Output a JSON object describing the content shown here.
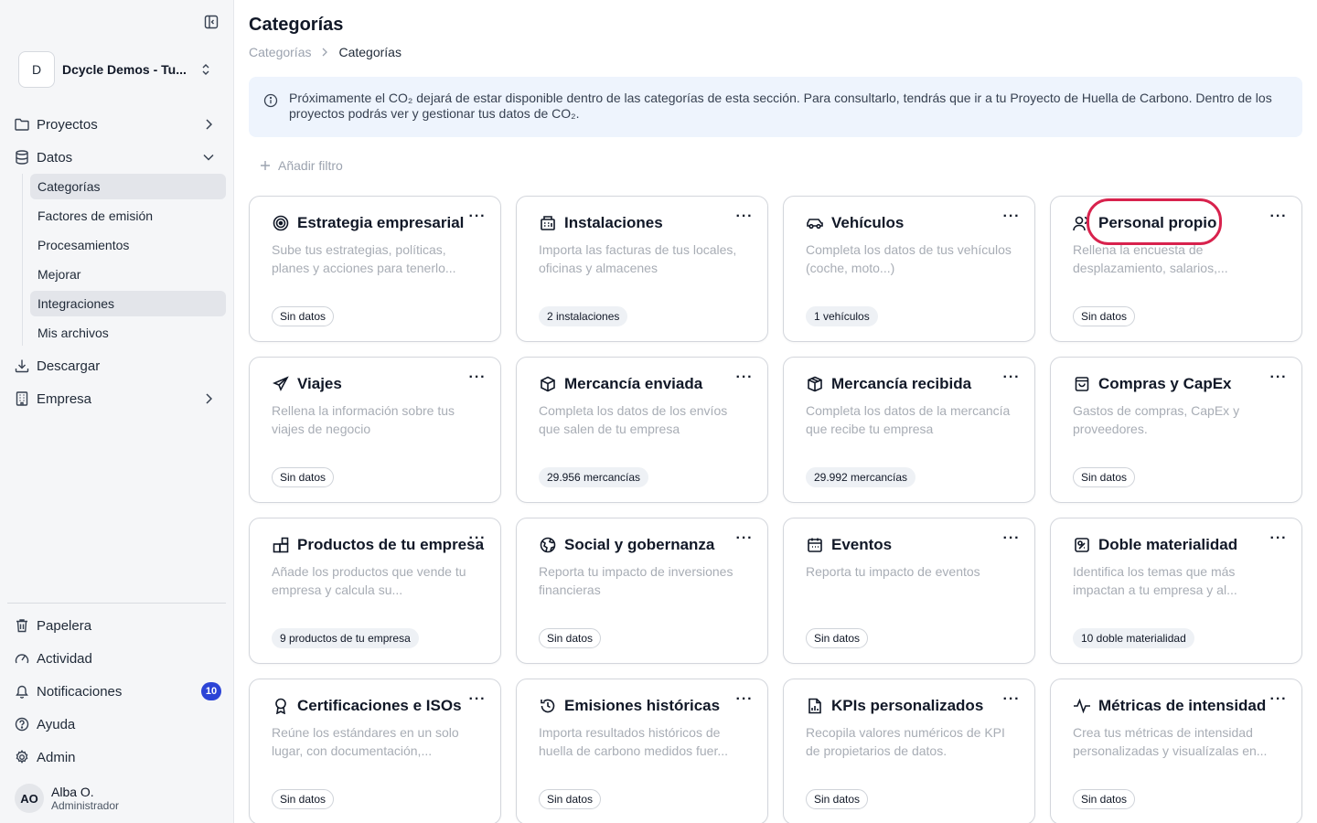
{
  "org": {
    "initial": "D",
    "name": "Dcycle Demos - Tu..."
  },
  "sidebar": {
    "projects": "Proyectos",
    "data": "Datos",
    "sub_items": [
      "Categorías",
      "Factores de emisión",
      "Procesamientos",
      "Mejorar",
      "Integraciones",
      "Mis archivos"
    ],
    "download": "Descargar",
    "company": "Empresa",
    "trash": "Papelera",
    "activity": "Actividad",
    "notifications": "Notificaciones",
    "notifications_count": "10",
    "help": "Ayuda",
    "admin": "Admin"
  },
  "user": {
    "initials": "AO",
    "name": "Alba O.",
    "role": "Administrador"
  },
  "page": {
    "title": "Categorías",
    "breadcrumb": [
      "Categorías",
      "Categorías"
    ],
    "info": "Próximamente el CO₂ dejará de estar disponible dentro de las categorías de esta sección. Para consultarlo, tendrás que ir a tu Proyecto de Huella de Carbono. Dentro de los proyectos podrás ver y gestionar tus datos de CO₂.",
    "add_filter": "Añadir filtro"
  },
  "cards": [
    {
      "title": "Estrategia empresarial",
      "icon": "target-icon",
      "desc": "Sube tus estrategias, políticas, planes y acciones para tenerlo...",
      "badge": "Sin datos",
      "filled": false
    },
    {
      "title": "Instalaciones",
      "icon": "building-icon",
      "desc": "Importa las facturas de tus locales, oficinas y almacenes",
      "badge": "2 instalaciones",
      "filled": true
    },
    {
      "title": "Vehículos",
      "icon": "car-icon",
      "desc": "Completa los datos de tus vehículos (coche, moto...)",
      "badge": "1 vehículos",
      "filled": true
    },
    {
      "title": "Personal propio",
      "icon": "users-icon",
      "desc": "Rellena la encuesta de desplazamiento, salarios,...",
      "badge": "Sin datos",
      "filled": false
    },
    {
      "title": "Viajes",
      "icon": "plane-icon",
      "desc": "Rellena la información sobre tus viajes de negocio",
      "badge": "Sin datos",
      "filled": false
    },
    {
      "title": "Mercancía enviada",
      "icon": "box-icon",
      "desc": "Completa los datos de los envíos que salen de tu empresa",
      "badge": "29.956 mercancías",
      "filled": true
    },
    {
      "title": "Mercancía recibida",
      "icon": "boxes-icon",
      "desc": "Completa los datos de la mercancía que recibe tu empresa",
      "badge": "29.992 mercancías",
      "filled": true
    },
    {
      "title": "Compras y CapEx",
      "icon": "shopping-bag-icon",
      "desc": "Gastos de compras, CapEx y proveedores.",
      "badge": "Sin datos",
      "filled": false
    },
    {
      "title": "Productos de tu empresa",
      "icon": "products-icon",
      "desc": "Añade los productos que vende tu empresa y calcula su...",
      "badge": "9 productos de tu empresa",
      "filled": true
    },
    {
      "title": "Social y gobernanza",
      "icon": "globe-icon",
      "desc": "Reporta tu impacto de inversiones financieras",
      "badge": "Sin datos",
      "filled": false
    },
    {
      "title": "Eventos",
      "icon": "calendar-icon",
      "desc": "Reporta tu impacto de eventos",
      "badge": "Sin datos",
      "filled": false
    },
    {
      "title": "Doble materialidad",
      "icon": "materiality-icon",
      "desc": "Identifica los temas que más impactan a tu empresa y al...",
      "badge": "10 doble materialidad",
      "filled": true
    },
    {
      "title": "Certificaciones e ISOs",
      "icon": "award-icon",
      "desc": "Reúne los estándares en un solo lugar, con documentación,...",
      "badge": "Sin datos",
      "filled": false
    },
    {
      "title": "Emisiones históricas",
      "icon": "history-icon",
      "desc": "Importa resultados históricos de huella de carbono medidos fuer...",
      "badge": "Sin datos",
      "filled": false
    },
    {
      "title": "KPIs personalizados",
      "icon": "file-chart-icon",
      "desc": "Recopila valores numéricos de KPI de propietarios de datos.",
      "badge": "Sin datos",
      "filled": false
    },
    {
      "title": "Métricas de intensidad",
      "icon": "activity-icon",
      "desc": "Crea tus métricas de intensidad personalizadas y visualízalas en...",
      "badge": "Sin datos",
      "filled": false
    }
  ],
  "card_menu": "···",
  "colors": {
    "accent": "#2c44d6",
    "highlight": "#d8224d",
    "info_bg": "#eef4fd"
  }
}
